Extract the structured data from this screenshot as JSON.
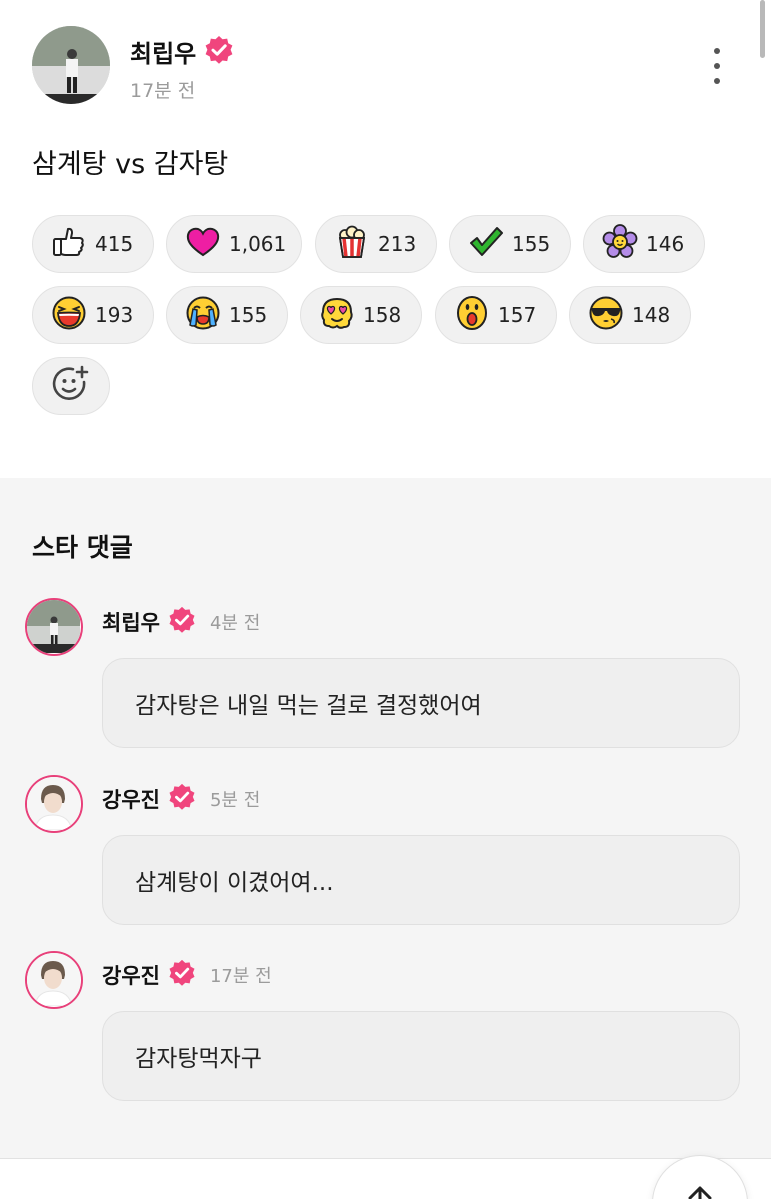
{
  "post": {
    "author": "최립우",
    "time": "17분 전",
    "text": "삼계탕 vs 감자탕"
  },
  "reactions": [
    {
      "icon": "thumbs-up-icon",
      "count": "415"
    },
    {
      "icon": "heart-icon",
      "count": "1,061"
    },
    {
      "icon": "popcorn-icon",
      "count": "213"
    },
    {
      "icon": "checkmark-icon",
      "count": "155"
    },
    {
      "icon": "flower-icon",
      "count": "146"
    },
    {
      "icon": "laughing-face-icon",
      "count": "193"
    },
    {
      "icon": "crying-face-icon",
      "count": "155"
    },
    {
      "icon": "heart-eyes-face-icon",
      "count": "158"
    },
    {
      "icon": "surprised-face-icon",
      "count": "157"
    },
    {
      "icon": "sunglasses-face-icon",
      "count": "148"
    }
  ],
  "comments_section": {
    "title": "스타 댓글",
    "items": [
      {
        "author": "최립우",
        "time": "4분 전",
        "text": "감자탕은 내일 먹는 걸로 결정했어여"
      },
      {
        "author": "강우진",
        "time": "5분 전",
        "text": "삼계탕이 이겼어여..."
      },
      {
        "author": "강우진",
        "time": "17분 전",
        "text": "감자탕먹자구"
      }
    ]
  },
  "colors": {
    "verified": "#f0457d",
    "avatar_ring": "#e8407a",
    "section_bg": "#f5f5f5"
  }
}
